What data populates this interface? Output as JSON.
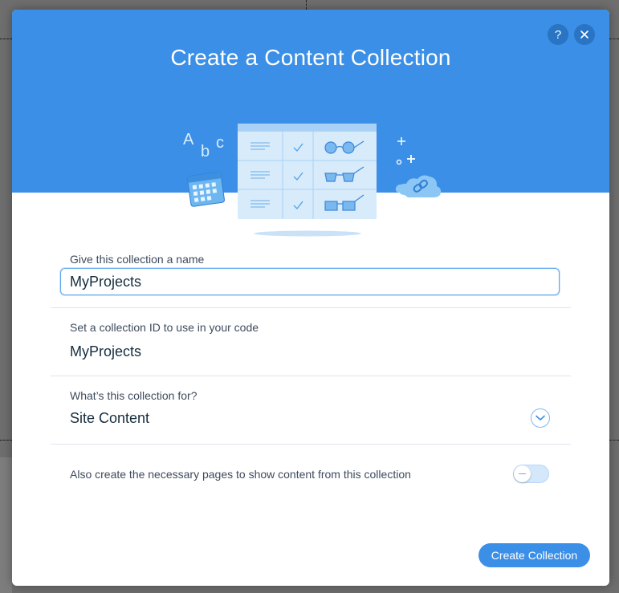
{
  "modal": {
    "title": "Create a Content Collection",
    "help_icon": "help-icon",
    "close_icon": "close-icon",
    "header_color": "#3b8fe6"
  },
  "illustration": {
    "letters": [
      "A",
      "b",
      "c"
    ],
    "icons": [
      "calendar-icon",
      "table-grid-icon",
      "glasses-icon",
      "sparkle-plus-icon",
      "cloud-link-icon"
    ]
  },
  "name_field": {
    "label": "Give this collection a name",
    "value": "MyProjects"
  },
  "id_field": {
    "label": "Set a collection ID to use in your code",
    "value": "MyProjects"
  },
  "purpose_field": {
    "label": "What’s this collection for?",
    "value": "Site Content",
    "icon": "chevron-down-icon"
  },
  "pages_toggle": {
    "label": "Also create the necessary pages to show content from this collection",
    "enabled": false
  },
  "actions": {
    "create_label": "Create Collection",
    "accent_color": "#3b8fe6"
  }
}
